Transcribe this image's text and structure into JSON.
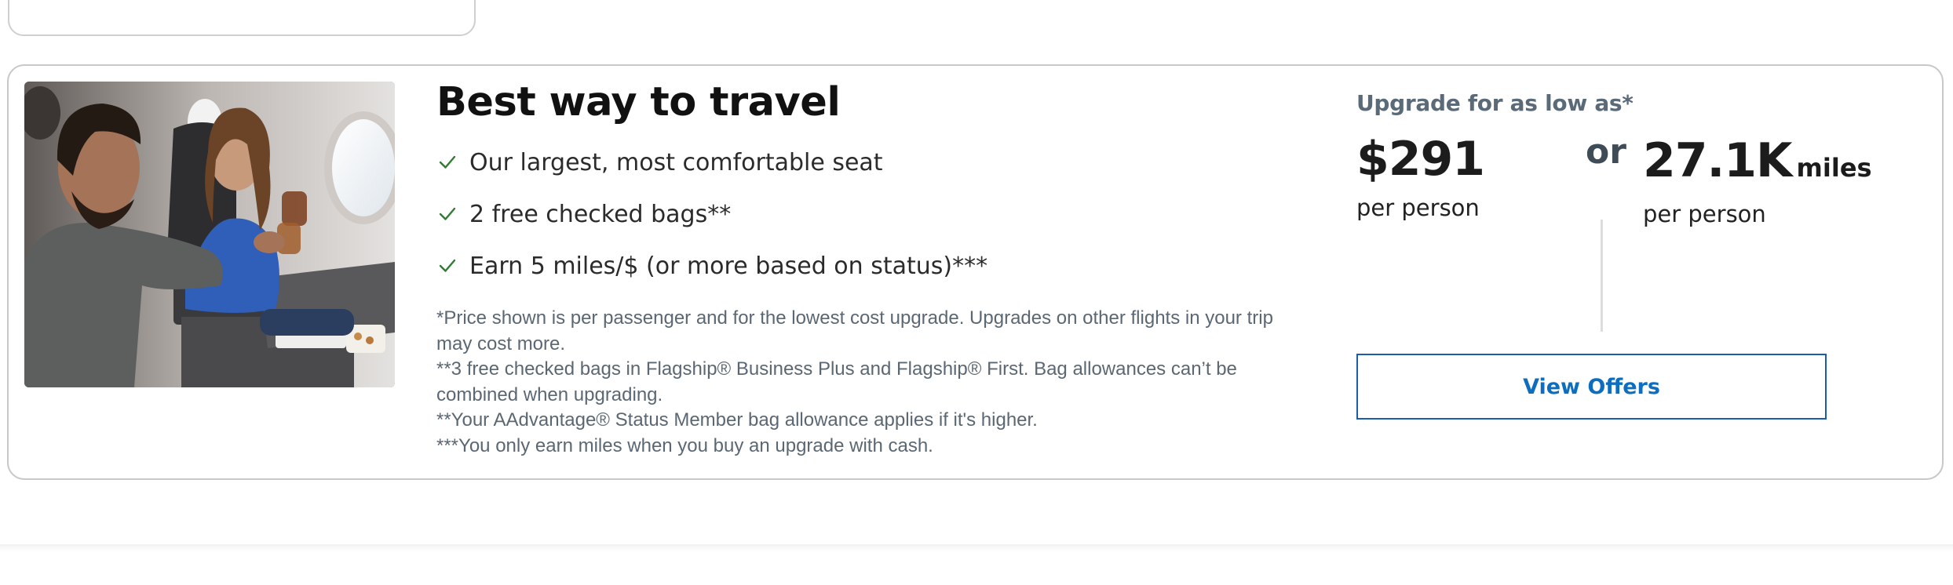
{
  "offer": {
    "title": "Best way to travel",
    "benefits": [
      {
        "icon": "check-icon",
        "text": "Our largest, most comfortable seat"
      },
      {
        "icon": "check-icon",
        "text": "2 free checked bags**"
      },
      {
        "icon": "check-icon",
        "text": "Earn 5 miles/$ (or more based on status)***"
      }
    ],
    "footnotes": [
      "*Price shown is per passenger and for the lowest cost upgrade. Upgrades on other flights in your trip may cost more.",
      "**3 free checked bags in Flagship® Business Plus and Flagship® First. Bag allowances can’t be combined when upgrading.",
      "**Your AAdvantage® Status Member bag allowance applies if it's higher.",
      "***You only earn miles when you buy an upgrade with cash."
    ]
  },
  "price": {
    "label": "Upgrade for as low as*",
    "cash_amount": "$291",
    "cash_per": "per person",
    "or_text": "or",
    "miles_amount": "27.1K",
    "miles_unit": "miles",
    "miles_per": "per person"
  },
  "actions": {
    "view_offers_label": "View Offers"
  },
  "colors": {
    "check": "#2e7d32",
    "button_border": "#1a5dab",
    "button_text": "#0d6ec0",
    "card_border": "#c8c8c8"
  }
}
